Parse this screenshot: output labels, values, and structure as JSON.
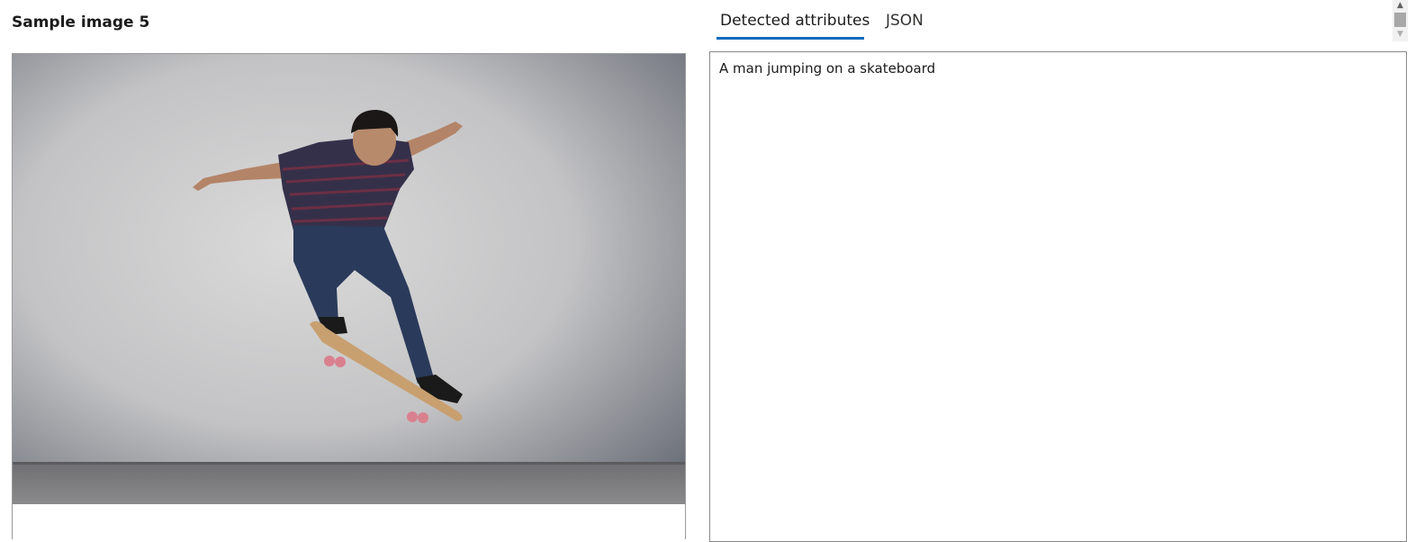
{
  "sample": {
    "title": "Sample image 5"
  },
  "image": {
    "alt": "A man jumping on a skateboard"
  },
  "tabs": [
    {
      "label": "Detected attributes",
      "active": true
    },
    {
      "label": "JSON",
      "active": false
    }
  ],
  "result": {
    "caption": "A man jumping on a skateboard"
  },
  "colors": {
    "accent": "#0f6cbd",
    "border": "#8a8a8a"
  },
  "icons": {
    "scroll_up": "chevron-up-icon",
    "scroll_down": "chevron-down-icon"
  }
}
